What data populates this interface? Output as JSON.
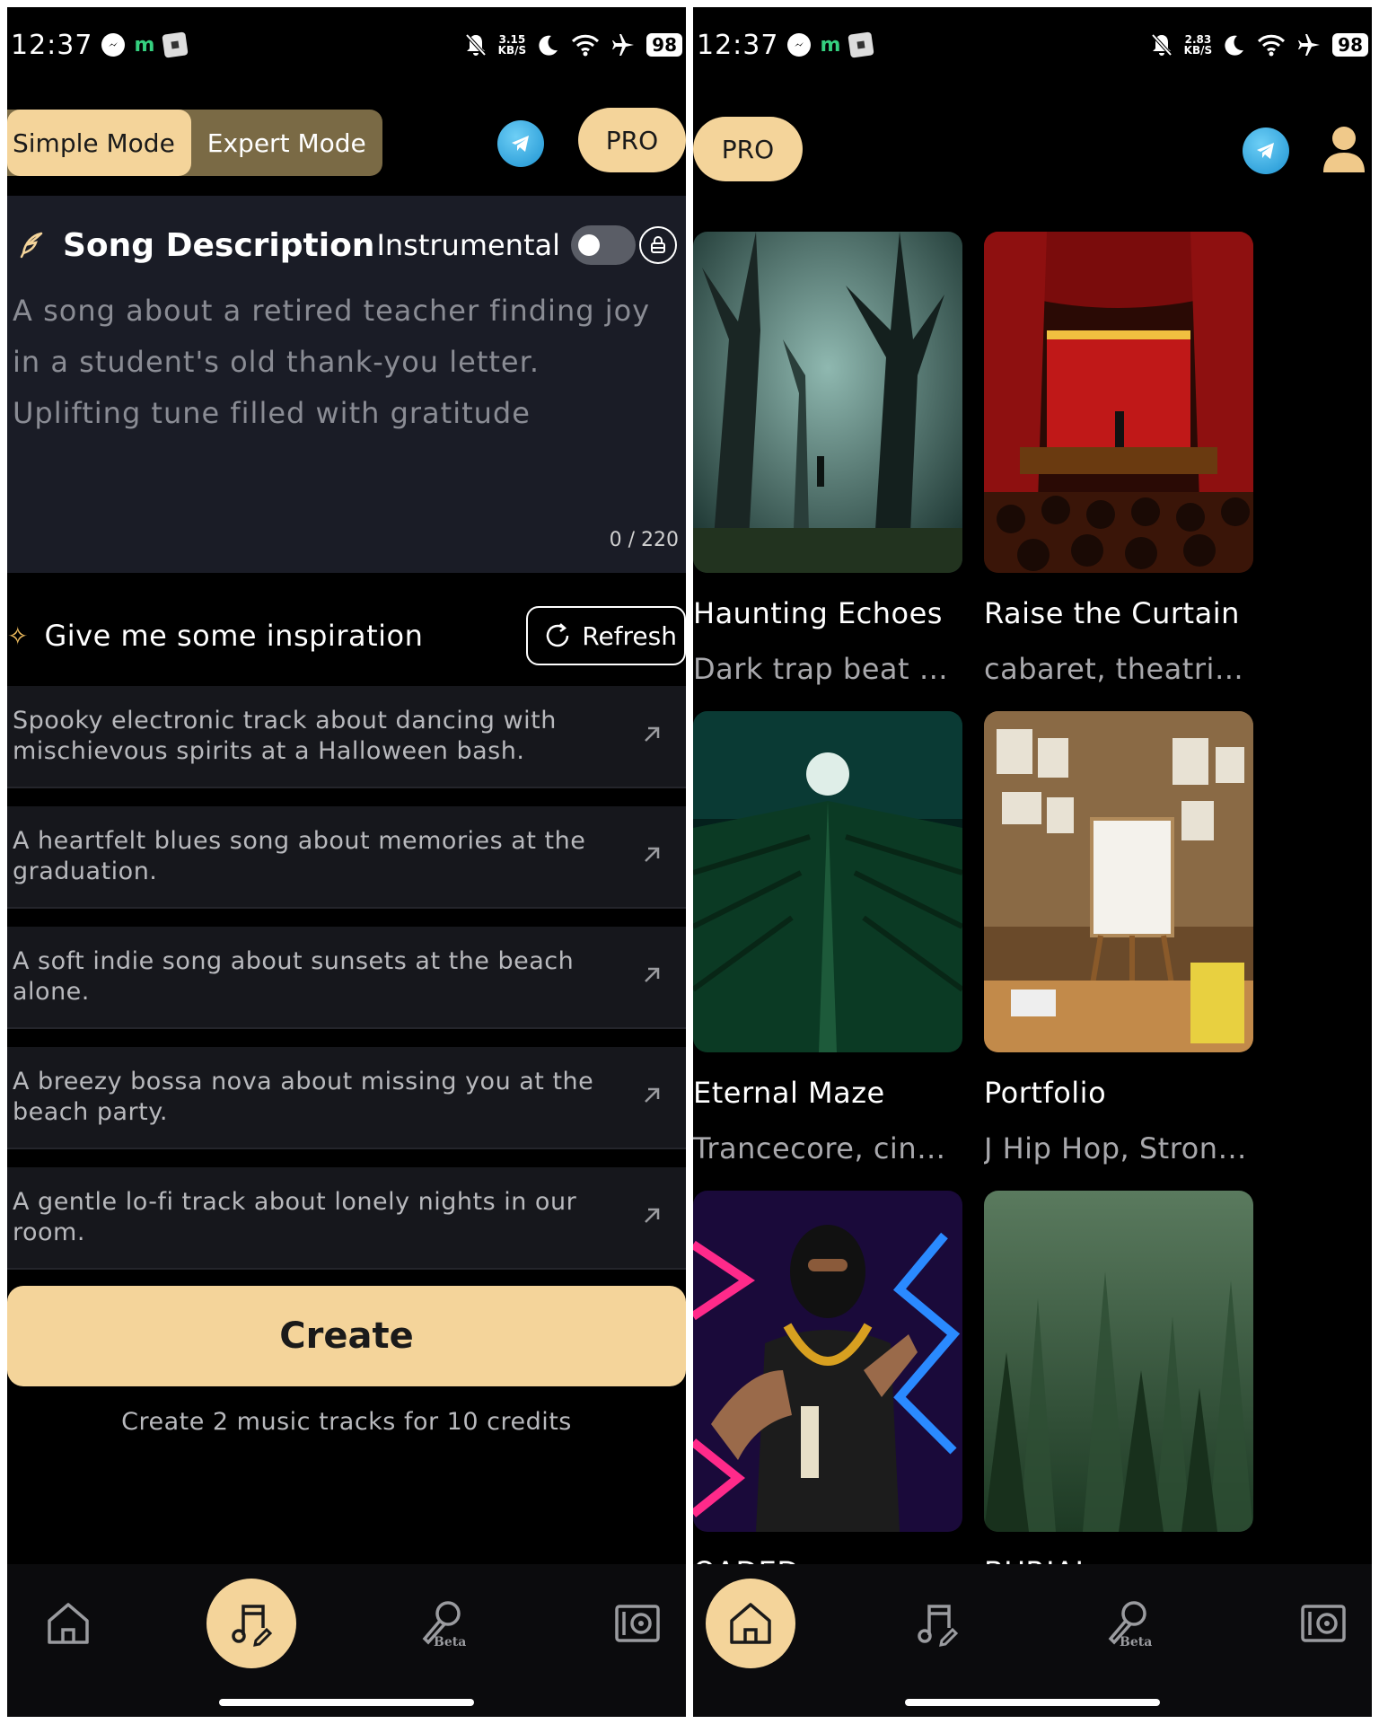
{
  "status_left": {
    "time": "12:37",
    "speed_value": "3.15",
    "speed_unit": "KB/S",
    "battery": "98"
  },
  "status_right": {
    "time": "12:37",
    "speed_value": "2.83",
    "speed_unit": "KB/S",
    "battery": "98"
  },
  "header": {
    "simple_mode": "Simple Mode",
    "expert_mode": "Expert Mode",
    "pro_label": "PRO"
  },
  "song_description": {
    "title": "Song Description",
    "instrumental_label": "Instrumental",
    "placeholder": "A song about a retired teacher finding joy in a student's old thank-you letter. Uplifting tune filled with gratitude",
    "counter": "0 / 220"
  },
  "inspiration": {
    "title": "Give me some inspiration",
    "refresh_label": "Refresh",
    "suggestions": [
      "Spooky electronic track about dancing with mischievous spirits at a Halloween bash.",
      "A heartfelt blues song about memories at the graduation.",
      "A soft indie song about sunsets at the beach alone.",
      "A breezy bossa nova about missing you at the beach party.",
      "A gentle lo-fi track about lonely nights in our room."
    ]
  },
  "create": {
    "label": "Create",
    "note": "Create 2 music tracks for 10 credits"
  },
  "nav": {
    "beta_label": "Beta"
  },
  "explore": {
    "pro_label": "PRO",
    "cards": [
      {
        "title": "Haunting Echoes",
        "subtitle": "Dark trap beat with ..."
      },
      {
        "title": "Raise the Curtain",
        "subtitle": "cabaret, theatrical ja..."
      },
      {
        "title": "Eternal Maze",
        "subtitle": "Trancecore, cinematic..."
      },
      {
        "title": "Portfolio",
        "subtitle": "J Hip Hop, Strong Ba..."
      },
      {
        "title": "OADED",
        "subtitle": ""
      },
      {
        "title": "BURIAL",
        "subtitle": ""
      }
    ]
  },
  "colors": {
    "accent": "#f4d49a",
    "background": "#000000",
    "card": "#1a1c26"
  }
}
